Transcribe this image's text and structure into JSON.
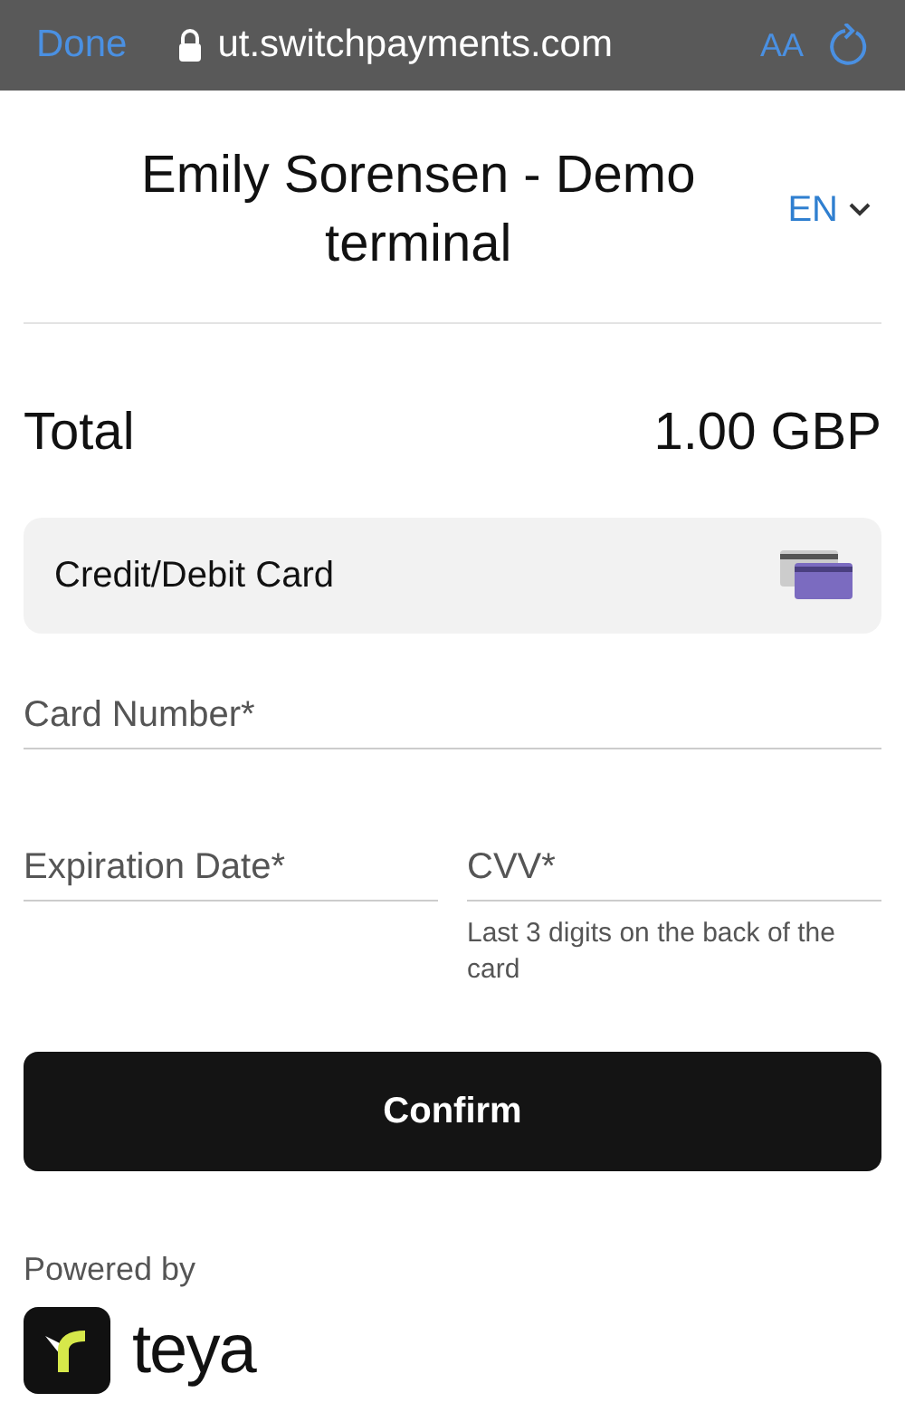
{
  "browser_bar": {
    "done": "Done",
    "url": "ut.switchpayments.com",
    "text_size": "AA"
  },
  "header": {
    "title": "Emily Sorensen - Demo terminal",
    "language": "EN"
  },
  "total": {
    "label": "Total",
    "amount": "1.00 GBP"
  },
  "payment_method": {
    "label": "Credit/Debit Card"
  },
  "fields": [
    {
      "placeholder": "Card Number*"
    },
    {
      "placeholder": "Expiration Date*"
    },
    {
      "placeholder": "CVV*",
      "hint": "Last 3 digits on the back of the card"
    }
  ],
  "confirm": "Confirm",
  "footer": {
    "powered_by": "Powered by",
    "brand": "teya"
  }
}
